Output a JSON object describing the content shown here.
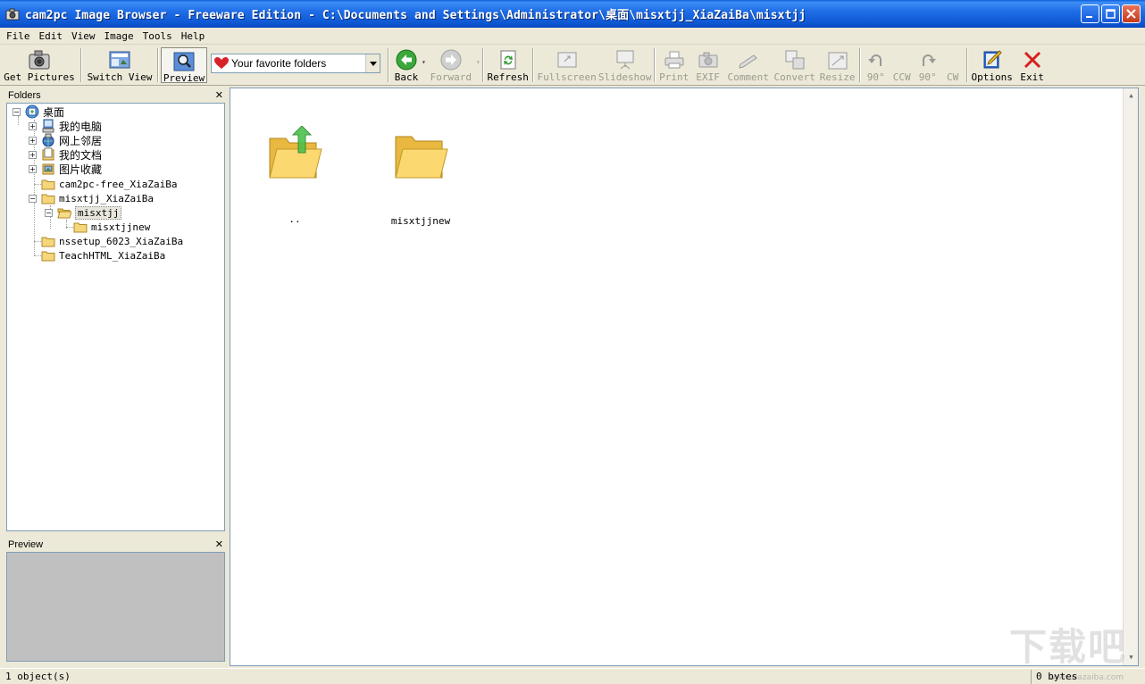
{
  "window": {
    "title": "cam2pc Image Browser - Freeware Edition - C:\\Documents and Settings\\Administrator\\桌面\\misxtjj_XiaZaiBa\\misxtjj"
  },
  "menu": [
    "File",
    "Edit",
    "View",
    "Image",
    "Tools",
    "Help"
  ],
  "toolbar": {
    "get_pictures": "Get Pictures",
    "switch_view": "Switch View",
    "preview": "Preview",
    "favorites": "Your favorite folders",
    "back": "Back",
    "forward": "Forward",
    "refresh": "Refresh",
    "fullscreen": "Fullscreen",
    "slideshow": "Slideshow",
    "print": "Print",
    "exif": "EXIF",
    "comment": "Comment",
    "convert": "Convert",
    "resize": "Resize",
    "rot_ccw_deg": "90°",
    "rot_ccw": "CCW",
    "rot_cw_deg": "90°",
    "rot_cw": "CW",
    "options": "Options",
    "exit": "Exit"
  },
  "folders_pane": {
    "title": "Folders",
    "tree": [
      {
        "label": "桌面",
        "level": 0,
        "expander": "minus",
        "icon": "desktop-icon"
      },
      {
        "label": "我的电脑",
        "level": 1,
        "expander": "plus",
        "icon": "computer-icon"
      },
      {
        "label": "网上邻居",
        "level": 1,
        "expander": "plus",
        "icon": "network-icon"
      },
      {
        "label": "我的文档",
        "level": 1,
        "expander": "plus",
        "icon": "documents-icon"
      },
      {
        "label": "图片收藏",
        "level": 1,
        "expander": "plus",
        "icon": "pictures-icon"
      },
      {
        "label": "cam2pc-free_XiaZaiBa",
        "level": 1,
        "expander": "none",
        "icon": "folder-icon"
      },
      {
        "label": "misxtjj_XiaZaiBa",
        "level": 1,
        "expander": "minus",
        "icon": "folder-icon"
      },
      {
        "label": "misxtjj",
        "level": 2,
        "expander": "minus",
        "icon": "folder-open-icon",
        "selected": true
      },
      {
        "label": "misxtjjnew",
        "level": 3,
        "expander": "none",
        "icon": "folder-icon"
      },
      {
        "label": "nssetup_6023_XiaZaiBa",
        "level": 1,
        "expander": "none",
        "icon": "folder-icon"
      },
      {
        "label": "TeachHTML_XiaZaiBa",
        "level": 1,
        "expander": "none",
        "icon": "folder-icon"
      }
    ]
  },
  "preview_pane": {
    "title": "Preview"
  },
  "main": {
    "items": [
      {
        "label": "..",
        "icon": "folder-up-icon"
      },
      {
        "label": "misxtjjnew",
        "icon": "folder-icon"
      }
    ]
  },
  "status": {
    "objects": "1 object(s)",
    "bytes": "0 bytes"
  },
  "watermark": {
    "text": "下载吧",
    "sub": "www.xiazaiba.com"
  }
}
